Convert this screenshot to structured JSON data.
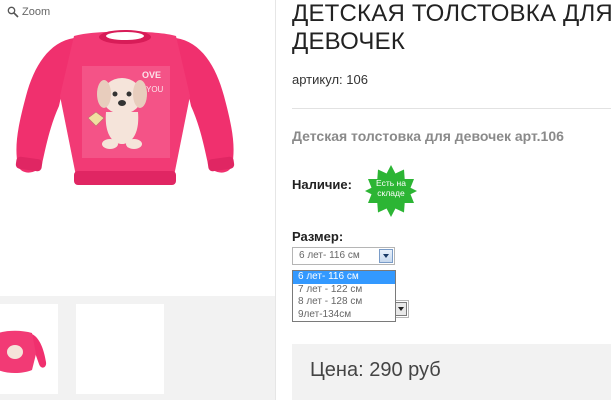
{
  "gallery": {
    "zoom_label": "Zoom"
  },
  "product": {
    "title": "ДЕТСКАЯ ТОЛСТОВКА ДЛЯ ДЕВОЧЕК",
    "sku_label": "артикул:",
    "sku_value": "106",
    "subtitle": "Детская толстовка для девочек арт.106",
    "availability_label": "Наличие:",
    "availability_badge": "Есть на складе",
    "size_label": "Размер:",
    "size_selected": "6 лет- 116 см",
    "size_options": [
      "6 лет- 116 см",
      "7 лет - 122 см",
      "8 лет - 128 см",
      "9лет-134см"
    ],
    "price": "Цена: 290 руб"
  },
  "colors": {
    "sweatshirt": "#f0306e",
    "badge": "#2cb534",
    "selected_option": "#3399ff"
  }
}
